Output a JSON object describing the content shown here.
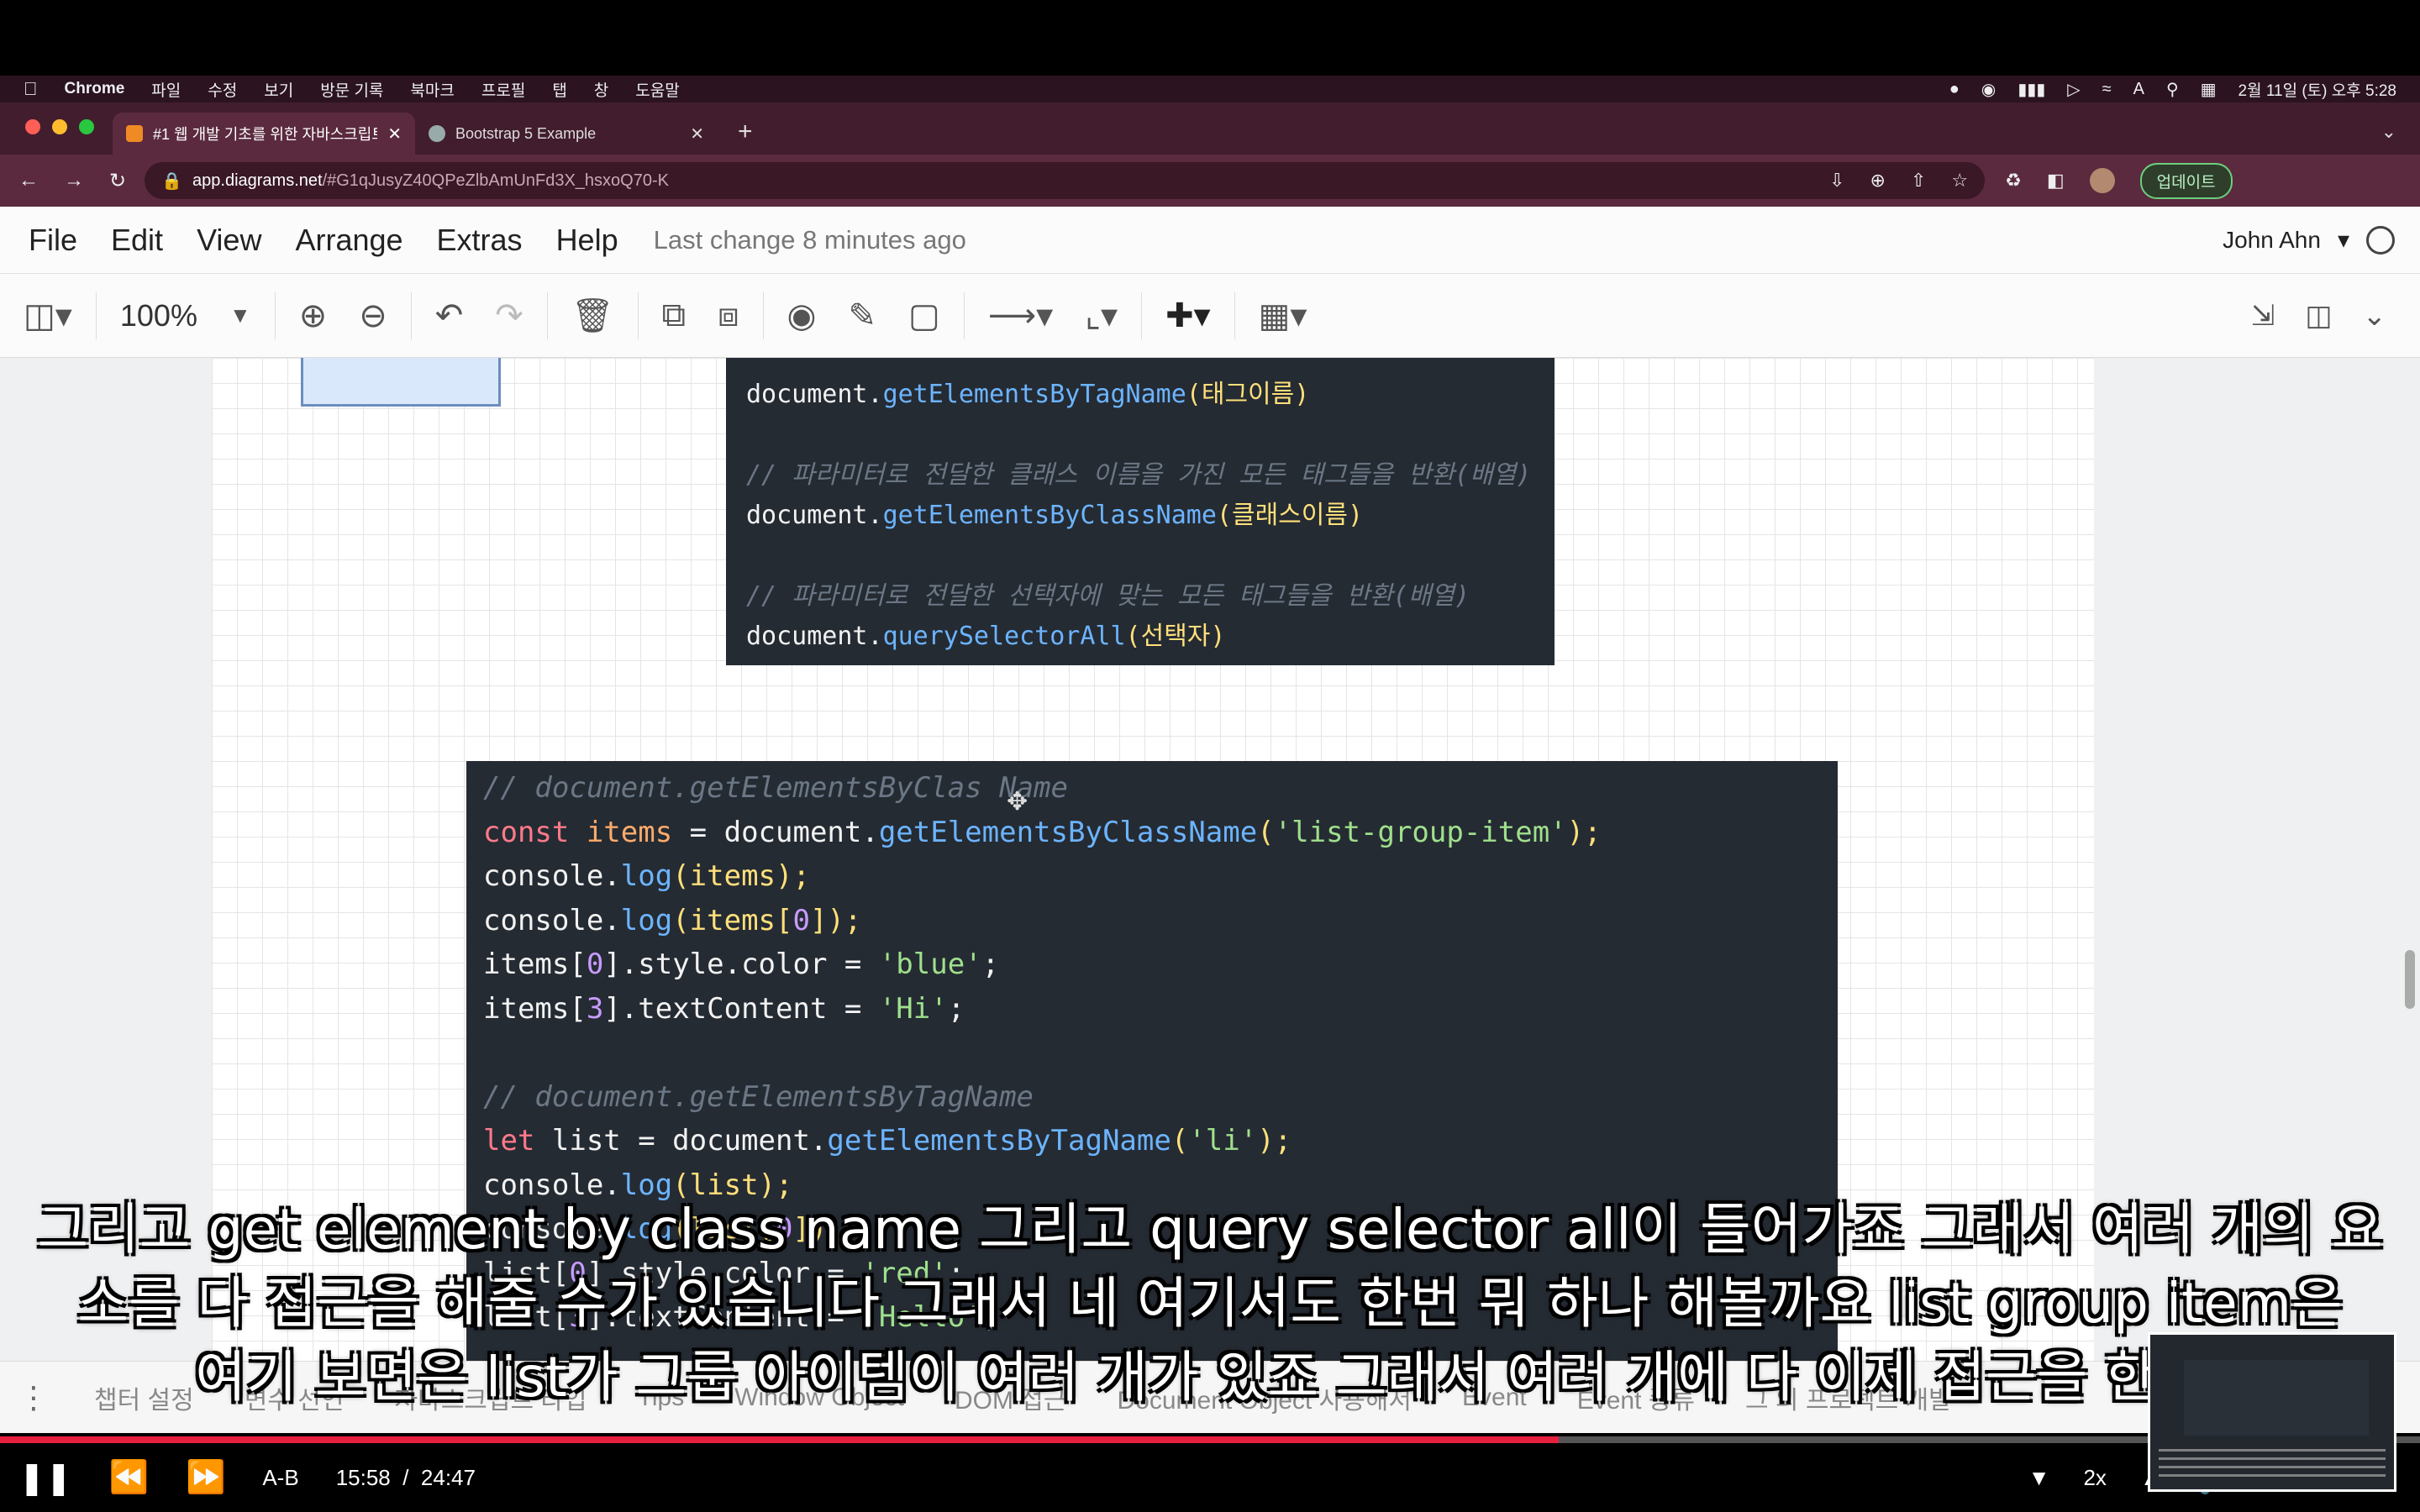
{
  "menubar": {
    "app": "Chrome",
    "items": [
      "파일",
      "수정",
      "보기",
      "방문 기록",
      "북마크",
      "프로필",
      "탭",
      "창",
      "도움말"
    ],
    "datetime": "2월 11일 (토) 오후 5:28",
    "input_source": "A"
  },
  "browser": {
    "tabs": [
      {
        "title": "#1 웹 개발 기초를 위한 자바스크립트",
        "active": true
      },
      {
        "title": "Bootstrap 5 Example",
        "active": false
      }
    ],
    "url_host": "app.diagrams.net",
    "url_path": "/#G1qJusyZ40QPeZlbAmUnFd3X_hsxoQ70-K",
    "update_label": "업데이트"
  },
  "drawio": {
    "menu": [
      "File",
      "Edit",
      "View",
      "Arrange",
      "Extras",
      "Help"
    ],
    "last_change": "Last change 8 minutes ago",
    "user": "John Ahn",
    "zoom": "100%"
  },
  "code1": {
    "line1_obj": "document.",
    "line1_fn": "getElementsByTagName",
    "line1_arg": "(태그이름)",
    "comment2": "// 파라미터로 전달한 클래스 이름을 가진 모든 태그들을 반환(배열)",
    "line2_obj": "document.",
    "line2_fn": "getElementsByClassName",
    "line2_arg": "(클래스이름)",
    "comment3": "// 파라미터로 전달한 선택자에 맞는 모든 태그들을 반환(배열)",
    "line3_obj": "document.",
    "line3_fn": "querySelectorAll",
    "line3_arg": "(선택자)"
  },
  "code2": {
    "c1": "// document.getElementsByClas",
    "c1b": "Name",
    "l2_kw": "const",
    "l2_var": " items",
    "l2_eq": " = document.",
    "l2_fn": "getElementsByClassName",
    "l2_p": "(",
    "l2_str": "'list-group-item'",
    "l2_end": ");",
    "l3_a": "console.",
    "l3_fn": "log",
    "l3_b": "(items);",
    "l4_a": "console.",
    "l4_fn": "log",
    "l4_b": "(items[",
    "l4_n": "0",
    "l4_c": "]);",
    "l5_a": "items[",
    "l5_n": "0",
    "l5_b": "].style.color = ",
    "l5_s": "'blue'",
    "l5_c": ";",
    "l6_a": "items[",
    "l6_n": "3",
    "l6_b": "].textContent = ",
    "l6_s": "'Hi'",
    "l6_c": ";",
    "c2": "// document.getElementsByTagName",
    "l8_kw": "let",
    "l8_a": " list = document.",
    "l8_fn": "getElementsByTagName",
    "l8_p": "(",
    "l8_s": "'li'",
    "l8_c": ");",
    "l9_a": "console.",
    "l9_fn": "log",
    "l9_b": "(list);",
    "l10_a": "console.",
    "l10_fn": "log",
    "l10_b": "(list[",
    "l10_n": "0",
    "l10_c": "]);",
    "l11_a": "list[",
    "l11_n": "0",
    "l11_b": "].style.color = ",
    "l11_s": "'red'",
    "l11_c": ";",
    "l12_a": "list[",
    "l12_n": "3",
    "l12_b": "].textContent = ",
    "l12_s": "'Hello'",
    "l12_c": ";"
  },
  "page_tabs": [
    "챕터 설정",
    "변수 선언",
    "자바스크립트 타입",
    "Tips",
    "Window Object",
    "DOM 접근",
    "Document Object 사용해서",
    "Event",
    "Event 종류",
    "그 외 프로젝트 개발"
  ],
  "subtitles": [
    "그리고 get element by class name 그리고 query selector all이 들어가죠 그래서 여러 개의 요",
    "소를 다 접근을 해줄 수가 있습니다 그래서 네 여기서도 한번 뭐 하나 해볼까요 list group item은",
    "여기 보면은 list가 그룹 아이템이 여러 개가 있죠 그래서 여러 개에 다 이제 접근을 한 다"
  ],
  "player": {
    "ab_label": "A-B",
    "current_time": "15:58",
    "separator": "/",
    "duration": "24:47",
    "speed": "2x",
    "progress": 0.644
  },
  "colors": {
    "code_bg": "#252b33",
    "progress": "#e8203f",
    "menubar": "#2b1320",
    "tabstrip": "#421d2d"
  }
}
